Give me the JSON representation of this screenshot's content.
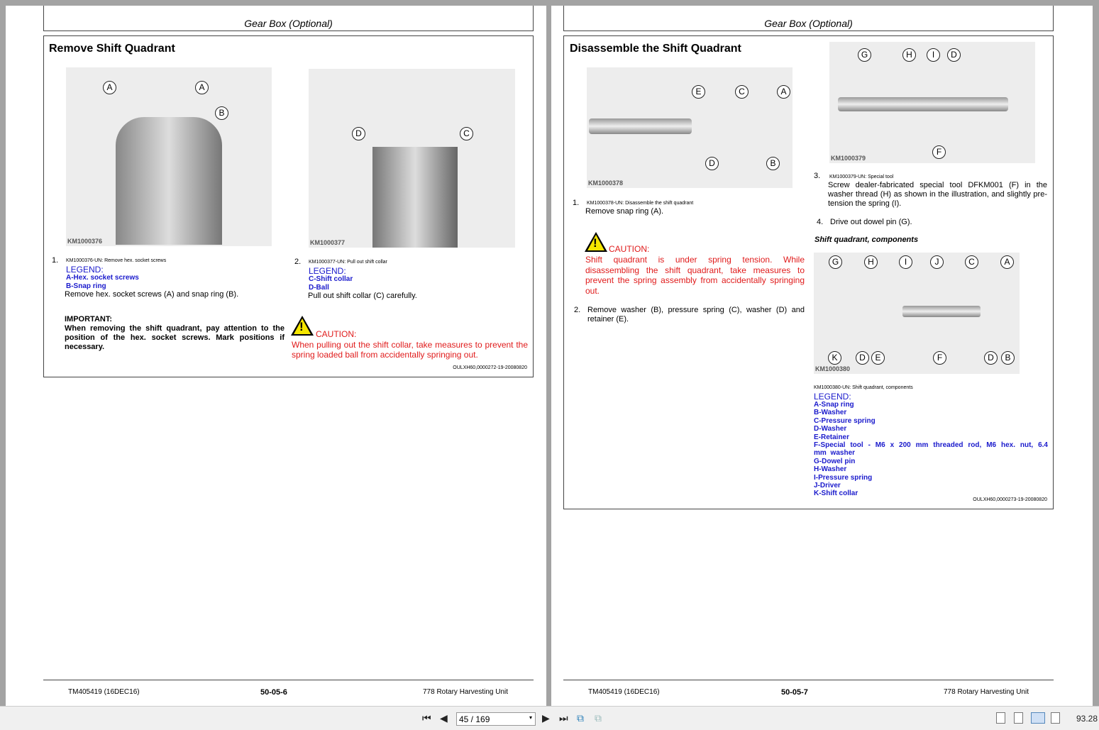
{
  "left_page": {
    "header": "Gear Box (Optional)",
    "title": "Remove Shift Quadrant",
    "fig1": {
      "code": "KM1000376",
      "callouts": [
        "A",
        "A",
        "B"
      ]
    },
    "fig2": {
      "code": "KM1000377",
      "callouts": [
        "D",
        "C"
      ]
    },
    "step1": {
      "num": "1.",
      "caption": "KM1000376-UN: Remove hex. socket screws",
      "legend": "LEGEND:",
      "items": [
        "A-Hex. socket screws",
        "B-Snap ring"
      ],
      "text": "Remove hex. socket screws (A) and snap ring (B)."
    },
    "step2": {
      "num": "2.",
      "caption": "KM1000377-UN: Pull out shift collar",
      "legend": "LEGEND:",
      "items": [
        "C-Shift collar",
        "D-Ball"
      ],
      "text": "Pull out shift collar (C) carefully."
    },
    "important_title": "IMPORTANT:",
    "important_text": "When removing the shift quadrant, pay attention to the position of the hex. socket screws. Mark positions if necessary.",
    "caution_title": "CAUTION:",
    "caution_text": "When pulling out the shift collar, take measures to prevent the spring loaded ball from accidentally springing out.",
    "ref": "OULXH60,0000272-19-20080820",
    "footer": {
      "left": "TM405419 (16DEC16)",
      "center": "50-05-6",
      "right": "778 Rotary Harvesting Unit"
    }
  },
  "right_page": {
    "header": "Gear Box (Optional)",
    "title": "Disassemble the Shift Quadrant",
    "fig1": {
      "code": "KM1000378",
      "callouts": [
        "E",
        "C",
        "A",
        "D",
        "B"
      ]
    },
    "fig2": {
      "code": "KM1000379",
      "callouts": [
        "G",
        "H",
        "I",
        "D",
        "F"
      ]
    },
    "fig3": {
      "code": "KM1000380",
      "callouts": [
        "G",
        "H",
        "I",
        "J",
        "C",
        "A",
        "K",
        "D",
        "E",
        "F",
        "D",
        "B"
      ]
    },
    "step1": {
      "num": "1.",
      "caption": "KM1000378-UN: Disassemble the shift quadrant",
      "text": "Remove snap ring (A)."
    },
    "caution_title": "CAUTION:",
    "caution_text": "Shift quadrant is under spring tension. While disassembling the shift quadrant, take measures to prevent the spring assembly from accidentally springing out.",
    "step2": {
      "num": "2.",
      "text": "Remove washer (B), pressure spring (C), washer (D) and retainer (E)."
    },
    "step3": {
      "num": "3.",
      "caption": "KM1000379-UN: Special tool",
      "text": "Screw dealer-fabricated special tool DFKM001 (F) in the washer thread (H) as shown in the illustration, and slightly pre-tension the spring (I)."
    },
    "step4": {
      "num": "4.",
      "text": "Drive out dowel pin (G)."
    },
    "components_title": "Shift quadrant, components",
    "fig3_caption": "KM1000380-UN: Shift quadrant, components",
    "legend": "LEGEND:",
    "legend_items": [
      "A-Snap ring",
      "B-Washer",
      "C-Pressure spring",
      "D-Washer",
      "E-Retainer",
      "F-Special tool - M6 x 200 mm threaded rod, M6 hex. nut, 6.4 mm washer",
      "G-Dowel pin",
      "H-Washer",
      "I-Pressure spring",
      "J-Driver",
      "K-Shift collar"
    ],
    "ref": "OULXH60,0000273-19-20080820",
    "footer": {
      "left": "TM405419 (16DEC16)",
      "center": "50-05-7",
      "right": "778 Rotary Harvesting Unit"
    }
  },
  "toolbar": {
    "page_value": "45 / 169",
    "zoom": "93.28"
  }
}
